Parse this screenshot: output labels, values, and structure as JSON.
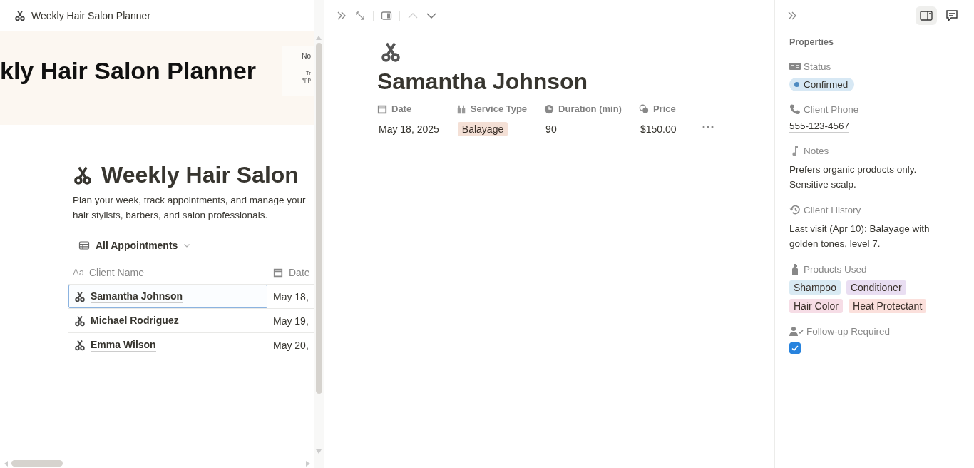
{
  "left_pane": {
    "breadcrumb": "Weekly Hair Salon Planner",
    "banner": {
      "title": "kly Hair Salon Planner",
      "side_card": [
        "No",
        "Tr",
        "app"
      ]
    },
    "heading": "Weekly Hair Salon",
    "description": [
      "Plan your week, track appointments, and manage your",
      "hair stylists, barbers, and salon professionals."
    ],
    "view": {
      "title": "All Appointments"
    },
    "table": {
      "columns": [
        {
          "label": "Aa",
          "title": "Client Name"
        },
        {
          "title": "Date"
        }
      ],
      "rows": [
        {
          "name": "Samantha Johnson",
          "date": "May 18,",
          "selected": true
        },
        {
          "name": "Michael Rodriguez",
          "date": "May 19,",
          "selected": false
        },
        {
          "name": "Emma Wilson",
          "date": "May 20,",
          "selected": false
        }
      ]
    }
  },
  "page": {
    "title": "Samantha Johnson",
    "properties": [
      {
        "name": "Date",
        "value": "May 18, 2025",
        "kind": "text"
      },
      {
        "name": "Service Type",
        "value": "Balayage",
        "kind": "tag",
        "color": "#f4e0d6"
      },
      {
        "name": "Duration (min)",
        "value": "90",
        "kind": "text"
      },
      {
        "name": "Price",
        "value": "$150.00",
        "kind": "text"
      }
    ]
  },
  "properties_panel": {
    "title": "Properties",
    "fields": [
      {
        "name": "Status",
        "kind": "status",
        "value": "Confirmed",
        "color": "#4e8ac0"
      },
      {
        "name": "Client Phone",
        "kind": "link",
        "value": "555-123-4567"
      },
      {
        "name": "Notes",
        "kind": "text",
        "value": [
          "Prefers organic products only.",
          "Sensitive scalp."
        ]
      },
      {
        "name": "Client History",
        "kind": "text",
        "value": [
          "Last visit (Apr 10): Balayage with",
          "golden tones, level 7."
        ]
      },
      {
        "name": "Products Used",
        "kind": "tags",
        "tags": [
          {
            "label": "Shampoo",
            "color": "#d9eaf3"
          },
          {
            "label": "Conditioner",
            "color": "#e9def2"
          },
          {
            "label": "Hair Color",
            "color": "#f6dde6"
          },
          {
            "label": "Heat Protectant",
            "color": "#fbe0dc"
          }
        ]
      },
      {
        "name": "Follow-up Required",
        "kind": "checkbox",
        "checked": true
      }
    ]
  }
}
